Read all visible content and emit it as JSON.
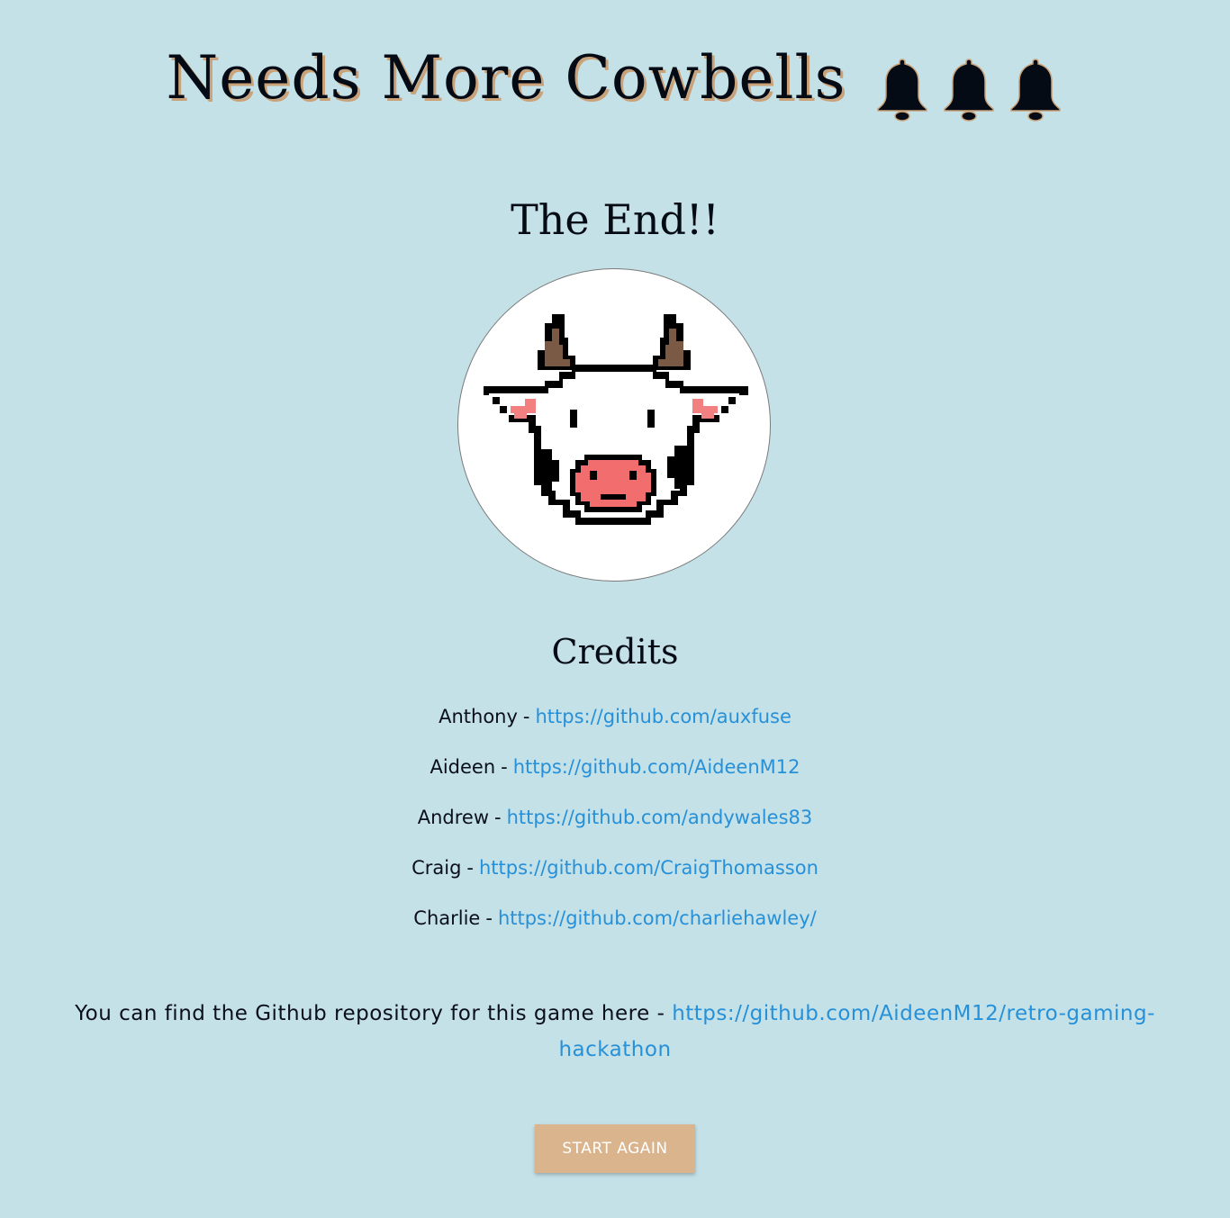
{
  "header": {
    "title": "Needs More Cowbells",
    "bells": [
      "bell-icon",
      "bell-icon",
      "bell-icon"
    ]
  },
  "main": {
    "end_heading": "The End!!",
    "cow_image": "cow-face-icon",
    "credits_heading": "Credits",
    "separator": "-",
    "credits": [
      {
        "name": "Anthony",
        "url": "https://github.com/auxfuse"
      },
      {
        "name": "Aideen",
        "url": "https://github.com/AideenM12"
      },
      {
        "name": "Andrew",
        "url": "https://github.com/andywales83"
      },
      {
        "name": "Craig",
        "url": "https://github.com/CraigThomasson"
      },
      {
        "name": "Charlie",
        "url": "https://github.com/charliehawley/"
      }
    ],
    "repo_text": "You can find the Github repository for this game here -",
    "repo_url": "https://github.com/AideenM12/retro-gaming-hackathon",
    "start_button": "START AGAIN"
  },
  "colors": {
    "background": "#c5e1e8",
    "title_shadow": "#c9a27a",
    "link": "#2690d8",
    "button": "#d9b48c",
    "cow_horn": "#7b5a45",
    "cow_nose": "#f26d6d"
  }
}
